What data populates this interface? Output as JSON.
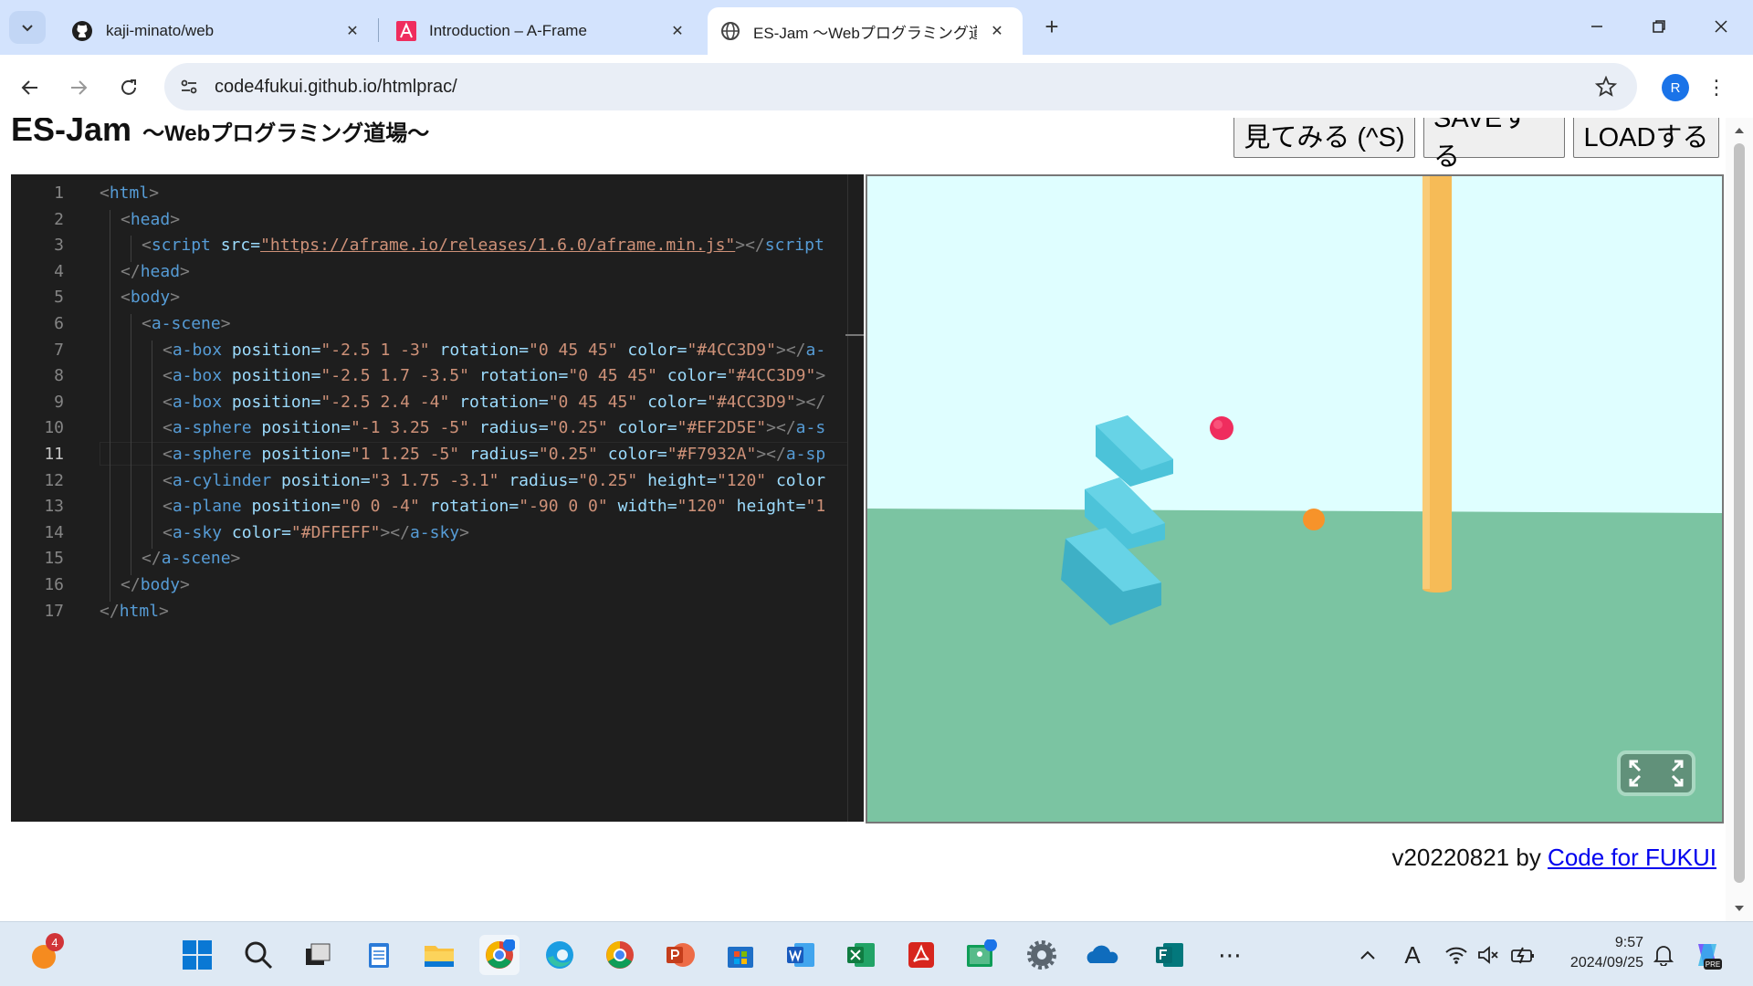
{
  "browser": {
    "tabs": [
      {
        "title": "kaji-minato/web",
        "icon": "github-icon"
      },
      {
        "title": "Introduction – A-Frame",
        "icon": "aframe-icon"
      },
      {
        "title": "ES-Jam 〜Webプログラミング道場〜",
        "icon": "globe-icon",
        "active": true
      }
    ],
    "url": "code4fukui.github.io/htmlprac/",
    "profile_initial": "R"
  },
  "app": {
    "title": "ES-Jam",
    "subtitle": "〜Webプログラミング道場〜",
    "buttons": {
      "preview": "見てみる (^S)",
      "save": "SAVEする",
      "load": "LOADする"
    },
    "footer": {
      "version": "v20220821 by ",
      "link": "Code for FUKUI"
    }
  },
  "editor": {
    "current_line": 11,
    "lines": [
      "1",
      "2",
      "3",
      "4",
      "5",
      "6",
      "7",
      "8",
      "9",
      "10",
      "11",
      "12",
      "13",
      "14",
      "15",
      "16",
      "17"
    ],
    "tokens": {
      "l1": [
        "<",
        "html",
        ">"
      ],
      "l2": [
        "<",
        "head",
        ">"
      ],
      "l3": [
        "<",
        "script",
        " src",
        "=",
        "\"https://aframe.io/releases/1.6.0/aframe.min.js\"",
        "></",
        "script"
      ],
      "l4": [
        "</",
        "head",
        ">"
      ],
      "l5": [
        "<",
        "body",
        ">"
      ],
      "l6": [
        "<",
        "a-scene",
        ">"
      ],
      "l7": [
        "<",
        "a-box",
        " position",
        "=",
        "\"-2.5 1 -3\"",
        " rotation",
        "=",
        "\"0 45 45\"",
        " color",
        "=",
        "\"#4CC3D9\"",
        "></",
        "a-"
      ],
      "l8": [
        "<",
        "a-box",
        " position",
        "=",
        "\"-2.5 1.7 -3.5\"",
        " rotation",
        "=",
        "\"0 45 45\"",
        " color",
        "=",
        "\"#4CC3D9\"",
        ">"
      ],
      "l9": [
        "<",
        "a-box",
        " position",
        "=",
        "\"-2.5 2.4 -4\"",
        " rotation",
        "=",
        "\"0 45 45\"",
        " color",
        "=",
        "\"#4CC3D9\"",
        "></"
      ],
      "l10": [
        "<",
        "a-sphere",
        " position",
        "=",
        "\"-1 3.25 -5\"",
        " radius",
        "=",
        "\"0.25\"",
        " color",
        "=",
        "\"#EF2D5E\"",
        "></",
        "a-s"
      ],
      "l11": [
        "<",
        "a-sphere",
        " position",
        "=",
        "\"1 1.25 -5\"",
        " radius",
        "=",
        "\"0.25\"",
        " color",
        "=",
        "\"#F7932A\"",
        "></",
        "a-sp"
      ],
      "l12": [
        "<",
        "a-cylinder",
        " position",
        "=",
        "\"3 1.75 -3.1\"",
        " radius",
        "=",
        "\"0.25\"",
        " height",
        "=",
        "\"120\"",
        " color"
      ],
      "l13": [
        "<",
        "a-plane",
        " position",
        "=",
        "\"0 0 -4\"",
        " rotation",
        "=",
        "\"-90 0 0\"",
        " width",
        "=",
        "\"120\"",
        " height",
        "=",
        "\"1"
      ],
      "l14": [
        "<",
        "a-sky",
        " color",
        "=",
        "\"#DFFEFF\"",
        "></",
        "a-sky",
        ">"
      ],
      "l15": [
        "</",
        "a-scene",
        ">"
      ],
      "l16": [
        "</",
        "body",
        ">"
      ],
      "l17": [
        "</",
        "html",
        ">"
      ]
    }
  },
  "scene_colors": {
    "sky": "#DFFEFF",
    "plane": "#7BC8A4",
    "box": "#4CC3D9",
    "sphere_red": "#EF2D5E",
    "sphere_orange": "#F7932A",
    "cylinder": "#FFC65D"
  },
  "taskbar": {
    "notification_count": "4",
    "time": "9:57",
    "date": "2024/09/25",
    "ime": "A",
    "apps": [
      "start-icon",
      "search-icon",
      "task-view-icon",
      "notepad-icon",
      "file-explorer-icon",
      "chrome-profile-icon",
      "edge-icon",
      "chrome-icon",
      "powerpoint-icon",
      "store-icon",
      "word-icon",
      "excel-icon",
      "acrobat-icon",
      "classroom-icon",
      "settings-icon",
      "onedrive-icon",
      "forms-icon",
      "more-icon"
    ]
  }
}
